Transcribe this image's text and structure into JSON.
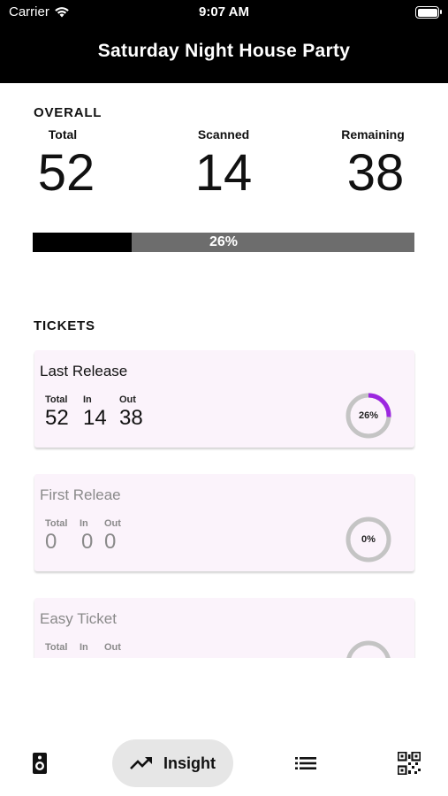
{
  "status_bar": {
    "carrier": "Carrier",
    "time": "9:07 AM"
  },
  "header": {
    "title": "Saturday Night House Party"
  },
  "overall": {
    "heading": "OVERALL",
    "total_label": "Total",
    "total_value": "52",
    "scanned_label": "Scanned",
    "scanned_value": "14",
    "remaining_label": "Remaining",
    "remaining_value": "38",
    "progress_text": "26%",
    "progress_fraction": 0.26
  },
  "tickets": {
    "heading": "TICKETS",
    "items": [
      {
        "name": "Last Release",
        "total_label": "Total",
        "in_label": "In",
        "out_label": "Out",
        "total": "52",
        "in": "14",
        "out": "38",
        "percent_text": "26%",
        "fraction": 0.26
      },
      {
        "name": "First Releae",
        "total_label": "Total",
        "in_label": "In",
        "out_label": "Out",
        "total": "0",
        "in": "0",
        "out": "0",
        "percent_text": "0%",
        "fraction": 0
      },
      {
        "name": "Easy Ticket",
        "total_label": "Total",
        "in_label": "In",
        "out_label": "Out",
        "total": "",
        "in": "",
        "out": "",
        "percent_text": "",
        "fraction": 0
      }
    ]
  },
  "bottom_nav": {
    "items": [
      {
        "icon": "speaker-icon"
      },
      {
        "icon": "trending-up-icon",
        "label": "Insight",
        "active": true
      },
      {
        "icon": "list-icon"
      },
      {
        "icon": "qr-code-icon"
      }
    ]
  },
  "colors": {
    "accent": "#9c27e0",
    "card_bg": "#fbf3fb",
    "ring_track": "#c4c4c4",
    "progress_track": "#6d6d6d"
  }
}
